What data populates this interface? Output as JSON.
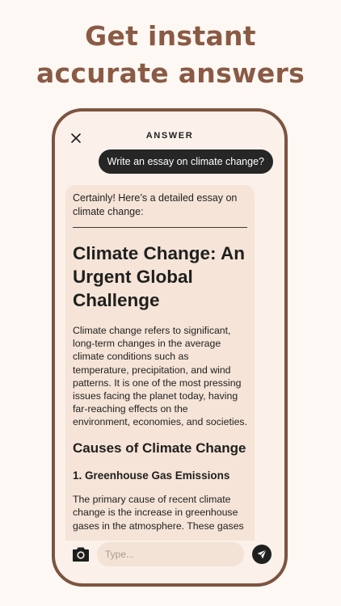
{
  "headline": {
    "line1": "Get instant",
    "line2": "accurate answers"
  },
  "header": {
    "title": "ANSWER",
    "close_icon": "close-icon"
  },
  "chat": {
    "user_message": "Write an essay on climate change?",
    "answer": {
      "intro": "Certainly! Here’s a detailed essay on climate change:",
      "title": "Climate Change: An Urgent Global Challenge",
      "paragraph1": "Climate change refers to significant, long-term changes in the average climate conditions such as temperature, precipitation, and wind patterns. It is one of the most pressing issues facing the planet today, having far-reaching effects on the environment, economies, and societies.",
      "section1_title": "Causes of Climate Change",
      "subsection1_title": "1. Greenhouse Gas Emissions",
      "paragraph2": "The primary cause of recent climate change is the increase in greenhouse gases in the atmosphere. These gases"
    }
  },
  "composer": {
    "placeholder": "Type...",
    "camera_icon": "camera-icon",
    "send_icon": "send-icon"
  },
  "colors": {
    "accent": "#8a5a44",
    "phone_frame": "#7d5440",
    "screen_bg": "#fbf1ea",
    "card_bg": "#f5e4d7",
    "user_bubble": "#262626"
  }
}
